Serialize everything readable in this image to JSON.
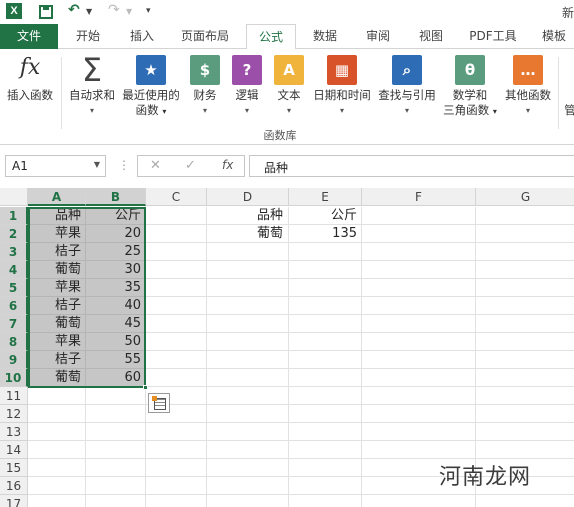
{
  "titlebar": {
    "app_icon": "excel-icon",
    "save_icon": "save-icon",
    "undo_icon": "undo-icon",
    "redo_icon": "redo-icon",
    "qat_more": "▾",
    "title_fragment": "新"
  },
  "tabs": [
    {
      "label": "文件",
      "kind": "file"
    },
    {
      "label": "开始"
    },
    {
      "label": "插入"
    },
    {
      "label": "页面布局"
    },
    {
      "label": "公式",
      "active": true
    },
    {
      "label": "数据"
    },
    {
      "label": "审阅"
    },
    {
      "label": "视图"
    },
    {
      "label": "PDF工具"
    },
    {
      "label": "模板"
    }
  ],
  "ribbon": {
    "buttons": [
      {
        "label": "插入函数",
        "icon": "insert-function-icon",
        "glyph": "fx",
        "color": "#ffffff"
      },
      {
        "label": "自动求和",
        "icon": "autosum-icon",
        "glyph": "Σ",
        "color": "#ffffff",
        "dropdown": "▾"
      },
      {
        "label": "最近使用的",
        "label2": "函数",
        "icon": "recent-functions-icon",
        "glyph": "★",
        "color": "#2e6db5",
        "dropdown": "▾"
      },
      {
        "label": "财务",
        "icon": "financial-icon",
        "glyph": "$",
        "color": "#5a9c7d",
        "dropdown": "▾"
      },
      {
        "label": "逻辑",
        "icon": "logical-icon",
        "glyph": "?",
        "color": "#9b4fa8",
        "dropdown": "▾"
      },
      {
        "label": "文本",
        "icon": "text-icon",
        "glyph": "A",
        "color": "#f0b43c",
        "dropdown": "▾"
      },
      {
        "label": "日期和时间",
        "icon": "date-time-icon",
        "glyph": "▦",
        "color": "#d9532a",
        "dropdown": "▾"
      },
      {
        "label": "查找与引用",
        "icon": "lookup-reference-icon",
        "glyph": "⌕",
        "color": "#2e6db5",
        "dropdown": "▾"
      },
      {
        "label": "数学和",
        "label2": "三角函数",
        "icon": "math-trig-icon",
        "glyph": "θ",
        "color": "#5a9c7d",
        "dropdown": "▾"
      },
      {
        "label": "其他函数",
        "icon": "more-functions-icon",
        "glyph": "…",
        "color": "#e8782f",
        "dropdown": "▾"
      }
    ],
    "group_name": "函数库",
    "cut_label": "管"
  },
  "formula_bar": {
    "name_box": "A1",
    "cancel": "✕",
    "enter": "✓",
    "fx": "fx",
    "content": "品种"
  },
  "sheet": {
    "columns": [
      "A",
      "B",
      "C",
      "D",
      "E",
      "F",
      "G"
    ],
    "rows": [
      "1",
      "2",
      "3",
      "4",
      "5",
      "6",
      "7",
      "8",
      "9",
      "10",
      "11",
      "12",
      "13",
      "14",
      "15",
      "16",
      "17"
    ],
    "data_ab": [
      [
        "品种",
        "公斤"
      ],
      [
        "苹果",
        "20"
      ],
      [
        "桔子",
        "25"
      ],
      [
        "葡萄",
        "30"
      ],
      [
        "苹果",
        "35"
      ],
      [
        "桔子",
        "40"
      ],
      [
        "葡萄",
        "45"
      ],
      [
        "苹果",
        "50"
      ],
      [
        "桔子",
        "55"
      ],
      [
        "葡萄",
        "60"
      ]
    ],
    "data_de": [
      [
        "品种",
        "公斤"
      ],
      [
        "葡萄",
        "135"
      ]
    ],
    "selection": "A1:B10"
  },
  "watermark": "河南龙网",
  "colors": {
    "accent": "#217346",
    "selection_fill": "#c6c6c6"
  }
}
